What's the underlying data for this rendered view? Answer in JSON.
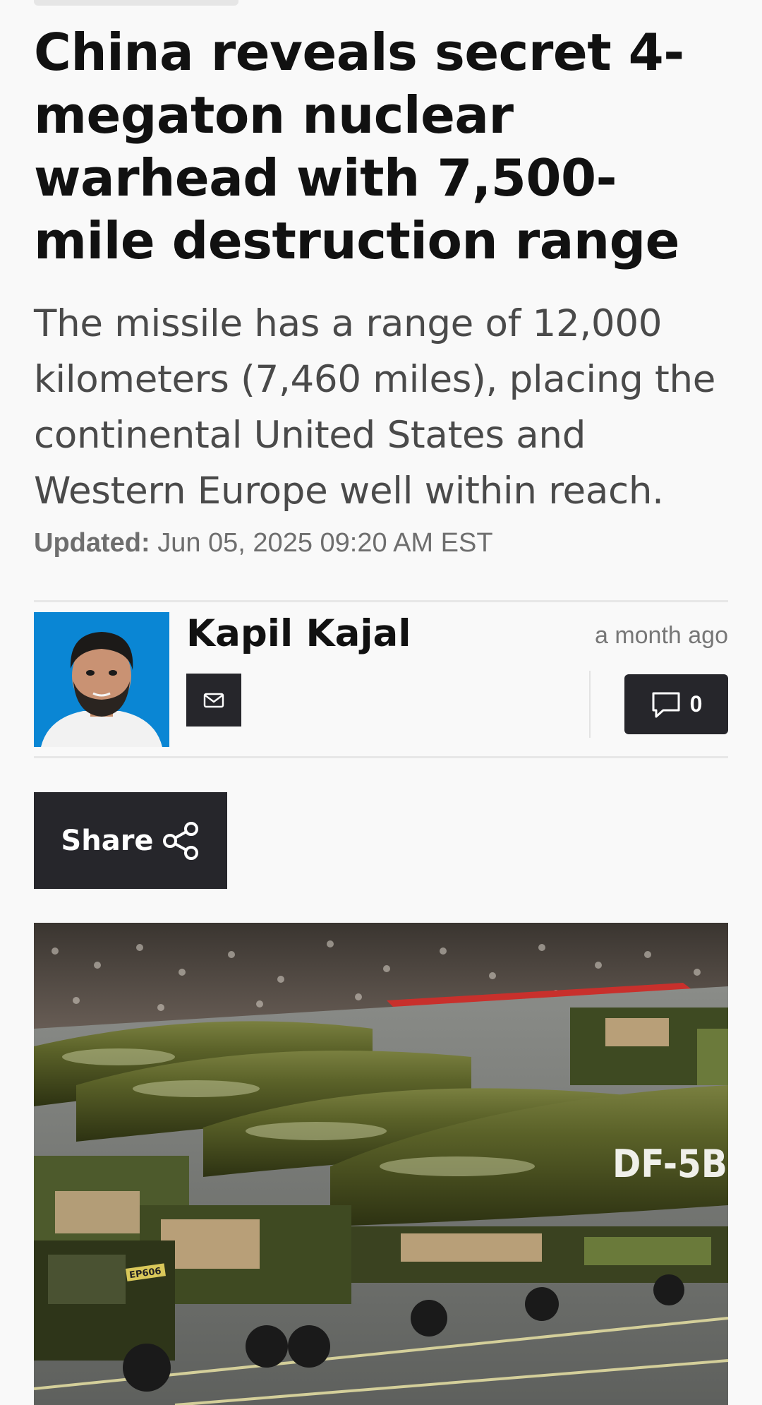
{
  "article": {
    "headline": "China reveals secret 4-megaton nuclear warhead with 7,500-mile destruction range",
    "subheadline": "The missile has a range of 12,000 kilometers (7,460 miles), placing the continental United States and Western Europe well within reach.",
    "updated_label": "Updated:",
    "updated_value": "Jun 05, 2025 09:20 AM EST"
  },
  "author": {
    "name": "Kapil Kajal",
    "time_ago": "a month ago"
  },
  "comments": {
    "count": "0"
  },
  "share": {
    "label": "Share"
  },
  "hero_image": {
    "missile_label": "DF-5B",
    "truck_plate": "EP606"
  },
  "colors": {
    "page_bg": "#f9f9f9",
    "button_dark": "#26262b",
    "avatar_bg": "#0a86d4"
  }
}
